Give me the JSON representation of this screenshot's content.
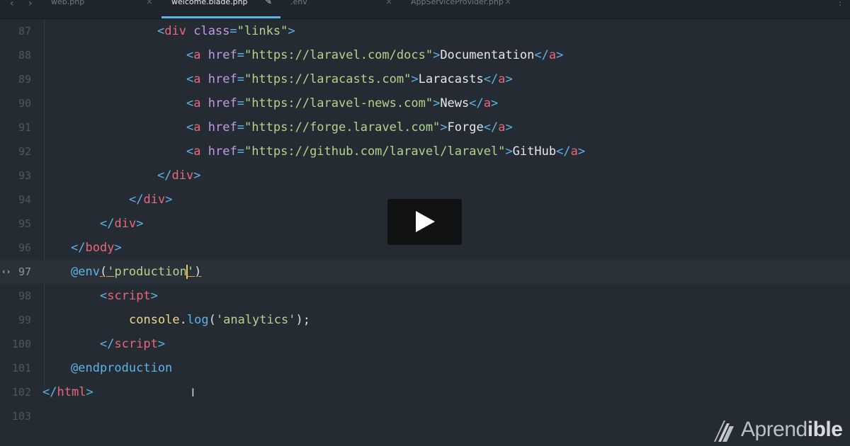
{
  "tabs": [
    {
      "label": "web.php",
      "active": false
    },
    {
      "label": "welcome.blade.php",
      "active": true
    },
    {
      "label": ".env",
      "active": false
    },
    {
      "label": "AppServiceProvider.php",
      "active": false
    }
  ],
  "editor": {
    "lines": [
      {
        "num": "87"
      },
      {
        "num": "88"
      },
      {
        "num": "89"
      },
      {
        "num": "90"
      },
      {
        "num": "91"
      },
      {
        "num": "92"
      },
      {
        "num": "93"
      },
      {
        "num": "94"
      },
      {
        "num": "95"
      },
      {
        "num": "96"
      },
      {
        "num": "97"
      },
      {
        "num": "98"
      },
      {
        "num": "99"
      },
      {
        "num": "100"
      },
      {
        "num": "101"
      },
      {
        "num": "102"
      },
      {
        "num": "103"
      }
    ],
    "current_line": "97",
    "code": {
      "l87": {
        "tag": "div",
        "attr": "class",
        "val": "\"links\""
      },
      "l88": {
        "tag": "a",
        "attr": "href",
        "val": "\"https://laravel.com/docs\"",
        "text": "Documentation"
      },
      "l89": {
        "tag": "a",
        "attr": "href",
        "val": "\"https://laracasts.com\"",
        "text": "Laracasts"
      },
      "l90": {
        "tag": "a",
        "attr": "href",
        "val": "\"https://laravel-news.com\"",
        "text": "News"
      },
      "l91": {
        "tag": "a",
        "attr": "href",
        "val": "\"https://forge.laravel.com\"",
        "text": "Forge"
      },
      "l92": {
        "tag": "a",
        "attr": "href",
        "val": "\"https://github.com/laravel/laravel\"",
        "text": "GitHub"
      },
      "l93": {
        "tag": "div"
      },
      "l94": {
        "tag": "div"
      },
      "l95": {
        "tag": "div"
      },
      "l96": {
        "tag": "body"
      },
      "l97": {
        "directive": "@env",
        "arg": "production"
      },
      "l98": {
        "tag": "script"
      },
      "l99": {
        "obj": "console",
        "method": "log",
        "arg": "'analytics'"
      },
      "l100": {
        "tag": "script"
      },
      "l101": {
        "directive": "@endproduction"
      },
      "l102": {
        "tag": "html"
      }
    }
  },
  "brand": {
    "name_a": "Aprend",
    "name_b": "ible"
  },
  "colors": {
    "background": "#242b33",
    "tag": "#e8677c",
    "attr": "#c39ae6",
    "string": "#b2d58a",
    "punct": "#5fb4e6",
    "accent": "#5fb4e6"
  }
}
